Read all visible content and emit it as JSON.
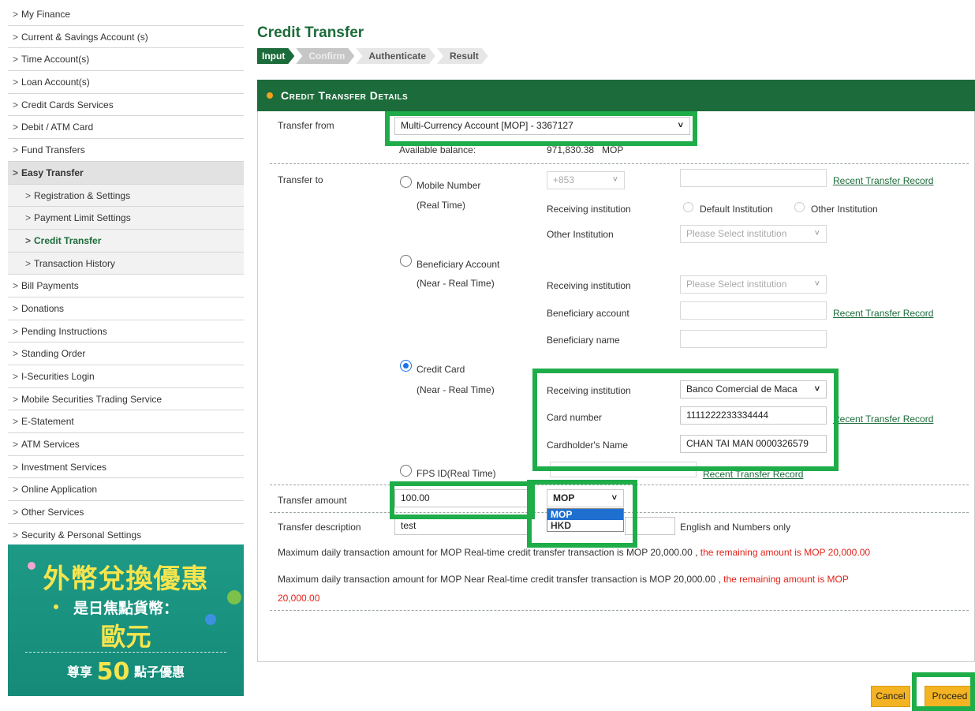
{
  "sidebar": {
    "items": [
      {
        "label": "My Finance"
      },
      {
        "label": "Current & Savings Account (s)"
      },
      {
        "label": "Time Account(s)"
      },
      {
        "label": "Loan Account(s)"
      },
      {
        "label": "Credit Cards Services"
      },
      {
        "label": "Debit / ATM Card"
      },
      {
        "label": "Fund Transfers"
      },
      {
        "label": "Easy Transfer"
      },
      {
        "label": "Registration & Settings"
      },
      {
        "label": "Payment Limit Settings"
      },
      {
        "label": "Credit Transfer"
      },
      {
        "label": "Transaction History"
      },
      {
        "label": "Bill Payments"
      },
      {
        "label": "Donations"
      },
      {
        "label": "Pending Instructions"
      },
      {
        "label": "Standing Order"
      },
      {
        "label": "I-Securities Login"
      },
      {
        "label": "Mobile Securities Trading Service"
      },
      {
        "label": "E-Statement"
      },
      {
        "label": "ATM Services"
      },
      {
        "label": "Investment Services"
      },
      {
        "label": "Online Application"
      },
      {
        "label": "Other Services"
      },
      {
        "label": "Security & Personal Settings"
      }
    ],
    "arrow": ">",
    "banner": {
      "line1": "外幣兌換優惠",
      "line2": "是日焦點貨幣：",
      "line3": "歐元",
      "line4_pre": "尊享",
      "line4_num": "50",
      "line4_post": "點子優惠"
    }
  },
  "page": {
    "title": "Credit Transfer",
    "steps": [
      "Input",
      "Confirm",
      "Authenticate",
      "Result"
    ],
    "section_title": "Credit Transfer Details"
  },
  "form": {
    "transfer_from_label": "Transfer from",
    "transfer_from_value": "Multi-Currency Account [MOP] - 3367127",
    "available_balance_label": "Available balance:",
    "available_balance_value": "971,830.38",
    "available_balance_currency": "MOP",
    "transfer_to_label": "Transfer to",
    "mobile": {
      "title": "Mobile Number",
      "subtitle": "(Real Time)",
      "country_code": "+853",
      "receiving_label": "Receiving institution",
      "opt_default": "Default Institution",
      "opt_other": "Other Institution",
      "other_inst_label": "Other Institution",
      "other_inst_placeholder": "Please Select institution",
      "record_link": "Recent Transfer Record"
    },
    "beneficiary": {
      "title": "Beneficiary Account",
      "subtitle": "(Near - Real Time)",
      "receiving_label": "Receiving institution",
      "receiving_placeholder": "Please Select institution",
      "account_label": "Beneficiary account",
      "name_label": "Beneficiary name",
      "record_link": "Recent Transfer Record"
    },
    "credit_card": {
      "title": "Credit Card",
      "subtitle": "(Near - Real Time)",
      "receiving_label": "Receiving institution",
      "receiving_value": "Banco Comercial de Maca",
      "card_label": "Card number",
      "card_value": "1111222233334444",
      "holder_label": "Cardholder's Name",
      "holder_value": "CHAN TAI MAN 0000326579",
      "record_link": "Recent Transfer Record"
    },
    "fps": {
      "title": "FPS ID(Real Time)",
      "record_link": "Recent Transfer Record"
    },
    "amount_label": "Transfer amount",
    "amount_value": "100.00",
    "currency_value": "MOP",
    "currency_options": [
      "MOP",
      "HKD"
    ],
    "description_label": "Transfer description",
    "description_value": "test",
    "description_hint": "English and Numbers only",
    "limit1_text": "Maximum daily transaction amount for MOP Real-time credit transfer transaction is MOP 20,000.00 ,",
    "limit1_remaining": "the remaining amount is MOP 20,000.00",
    "limit2_text": "Maximum daily transaction amount for MOP Near Real-time credit transfer transaction is MOP 20,000.00 ,",
    "limit2_remaining_a": "the remaining amount is MOP",
    "limit2_remaining_b": "20,000.00"
  },
  "buttons": {
    "cancel": "Cancel",
    "proceed": "Proceed"
  },
  "colors": {
    "brand_green": "#1c6b3a",
    "highlight": "#1fad4a",
    "button": "#f4b323",
    "warning_red": "#e2231a"
  }
}
